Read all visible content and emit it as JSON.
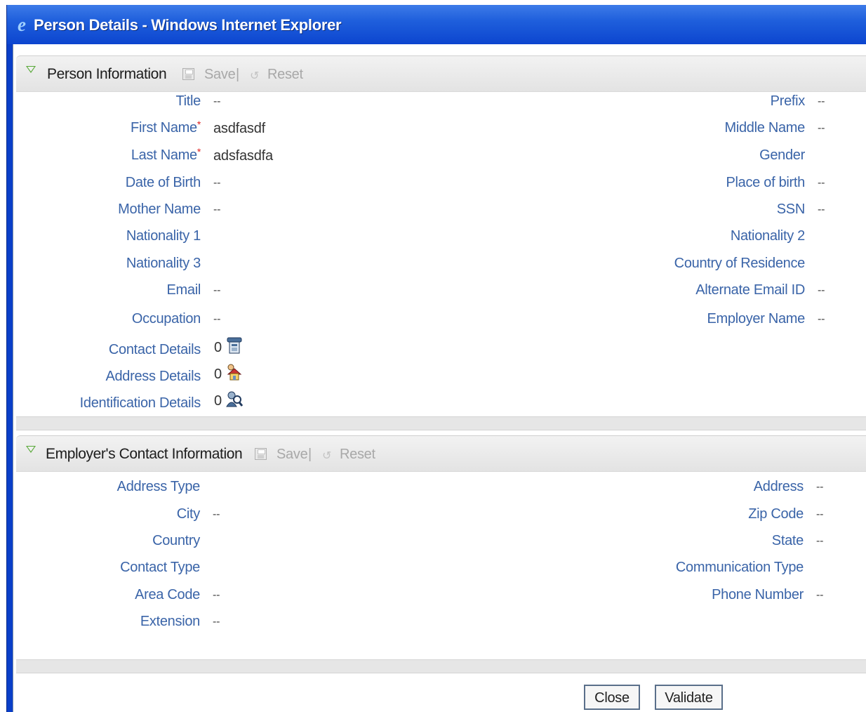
{
  "window": {
    "title": "Person Details - Windows Internet Explorer"
  },
  "person_panel": {
    "title": "Person Information",
    "save_label": "Save",
    "reset_label": "Reset",
    "separator": "|",
    "left_fields": [
      {
        "label": "Title",
        "value": "--"
      },
      {
        "label": "First Name",
        "required": "*",
        "value": "asdfasdf"
      },
      {
        "label": "Last Name",
        "required": "*",
        "value": "adsfasdfa"
      },
      {
        "label": "Date of Birth",
        "value": "--"
      },
      {
        "label": "Mother Name",
        "value": "--"
      },
      {
        "label": "Nationality 1",
        "value": ""
      },
      {
        "label": "Nationality 3",
        "value": ""
      },
      {
        "label": "Email",
        "value": "--"
      },
      {
        "label": "Occupation",
        "value": "--"
      }
    ],
    "right_fields": [
      {
        "label": "Prefix",
        "value": "--"
      },
      {
        "label": "Middle Name",
        "value": "--"
      },
      {
        "label": "Gender",
        "value": ""
      },
      {
        "label": "Place of birth",
        "value": "--"
      },
      {
        "label": "SSN",
        "value": "--"
      },
      {
        "label": "Nationality 2",
        "value": ""
      },
      {
        "label": "Country of Residence",
        "value": ""
      },
      {
        "label": "Alternate Email ID",
        "value": "--"
      },
      {
        "label": "Employer Name",
        "value": "--"
      }
    ],
    "detail_links": [
      {
        "label": "Contact Details",
        "count": "0",
        "icon": "phone-icon"
      },
      {
        "label": "Address Details",
        "count": "0",
        "icon": "house-icon"
      },
      {
        "label": "Identification Details",
        "count": "0",
        "icon": "identification-icon"
      }
    ]
  },
  "employer_panel": {
    "title": "Employer's Contact Information",
    "save_label": "Save",
    "reset_label": "Reset",
    "separator": "|",
    "left_fields": [
      {
        "label": "Address Type",
        "value": ""
      },
      {
        "label": "City",
        "value": "--"
      },
      {
        "label": "Country",
        "value": ""
      },
      {
        "label": "Contact Type",
        "value": ""
      },
      {
        "label": "Area Code",
        "value": "--"
      },
      {
        "label": "Extension",
        "value": "--"
      }
    ],
    "right_fields": [
      {
        "label": "Address",
        "value": "--"
      },
      {
        "label": "Zip Code",
        "value": "--"
      },
      {
        "label": "State",
        "value": "--"
      },
      {
        "label": "Communication Type",
        "value": ""
      },
      {
        "label": "Phone Number",
        "value": "--"
      }
    ]
  },
  "footer": {
    "close_label": "Close",
    "validate_label": "Validate"
  },
  "colors": {
    "label": "#3a64a8",
    "required": "#dd2222",
    "titlebar": "#1f5fdc"
  }
}
